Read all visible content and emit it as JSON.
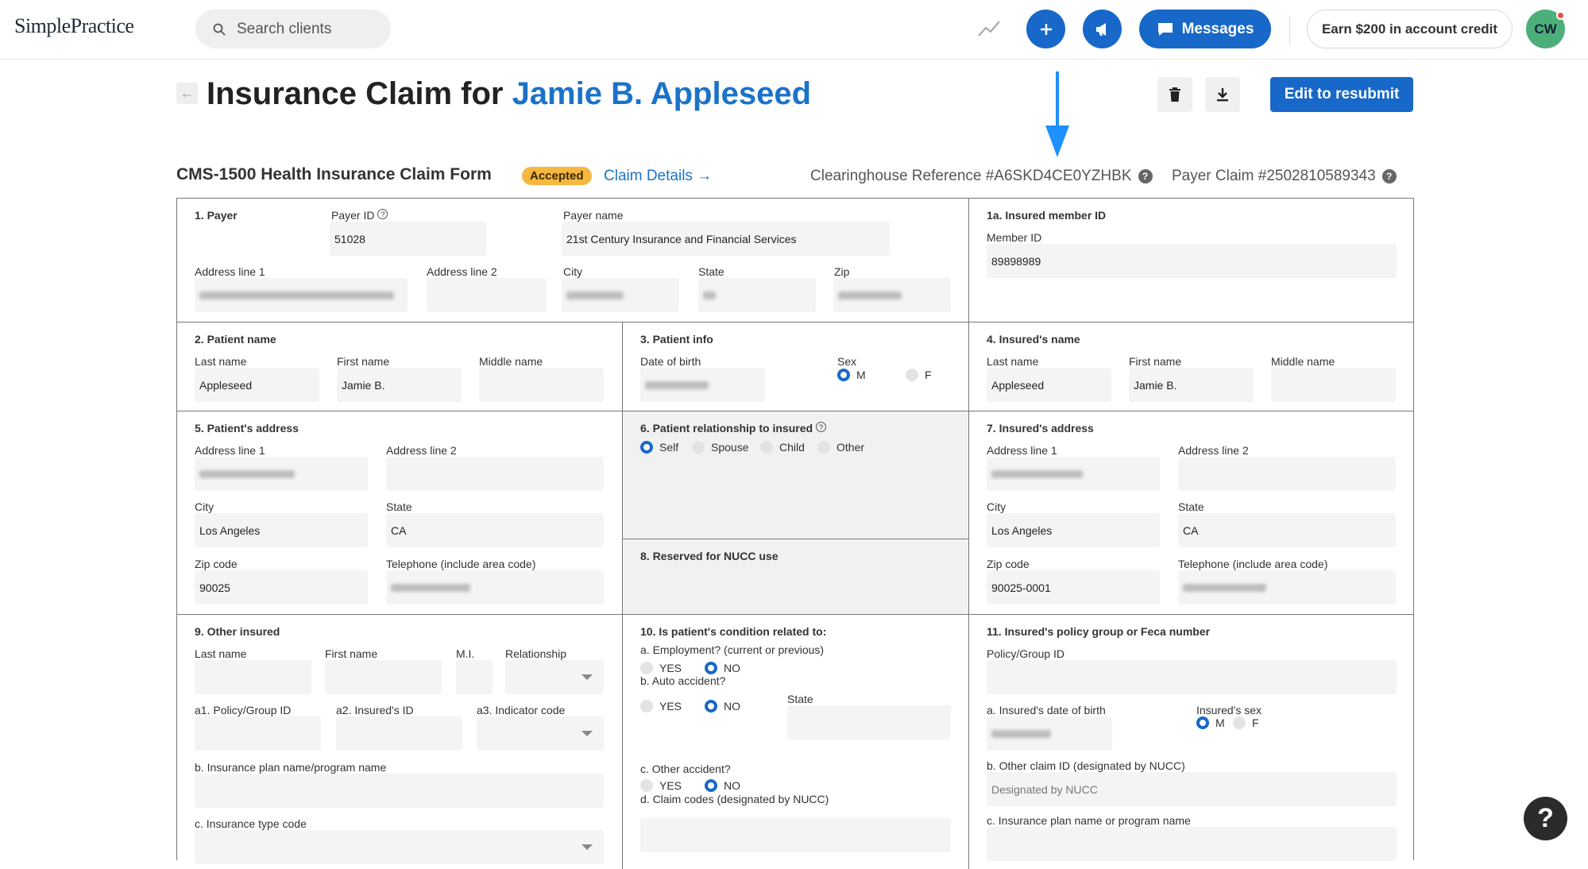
{
  "header": {
    "logo": "SimplePractice",
    "search_placeholder": "Search clients",
    "messages_label": "Messages",
    "earn_label": "Earn $200 in account credit",
    "avatar_initials": "CW"
  },
  "page": {
    "title_prefix": "Insurance Claim for",
    "client_name": "Jamie B. Appleseed",
    "edit_button": "Edit to resubmit"
  },
  "form_header": {
    "title": "CMS-1500 Health Insurance Claim Form",
    "status": "Accepted",
    "claim_details_link": "Claim Details →",
    "clearinghouse_ref": "Clearinghouse Reference #A6SKD4CE0YZHBK",
    "payer_claim": "Payer Claim #2502810589343"
  },
  "s1": {
    "title": "1. Payer",
    "payer_id_label": "Payer ID",
    "payer_id": "51028",
    "payer_name_label": "Payer name",
    "payer_name": "21st Century Insurance and Financial Services",
    "address1_label": "Address line 1",
    "address2_label": "Address line 2",
    "city_label": "City",
    "state_label": "State",
    "zip_label": "Zip"
  },
  "s1a": {
    "title": "1a. Insured member ID",
    "member_id_label": "Member ID",
    "member_id": "89898989"
  },
  "s2": {
    "title": "2. Patient name",
    "last_label": "Last name",
    "last": "Appleseed",
    "first_label": "First name",
    "first": "Jamie B.",
    "middle_label": "Middle name"
  },
  "s3": {
    "title": "3. Patient info",
    "dob_label": "Date of birth",
    "sex_label": "Sex",
    "m": "M",
    "f": "F"
  },
  "s4": {
    "title": "4. Insured's name",
    "last_label": "Last name",
    "last": "Appleseed",
    "first_label": "First name",
    "first": "Jamie B.",
    "middle_label": "Middle name"
  },
  "s5": {
    "title": "5. Patient's address",
    "address1_label": "Address line 1",
    "address2_label": "Address line 2",
    "city_label": "City",
    "city": "Los Angeles",
    "state_label": "State",
    "state": "CA",
    "zip_label": "Zip code",
    "zip": "90025",
    "phone_label": "Telephone (include area code)"
  },
  "s6": {
    "title": "6. Patient relationship to insured",
    "self": "Self",
    "spouse": "Spouse",
    "child": "Child",
    "other": "Other"
  },
  "s7": {
    "title": "7. Insured's address",
    "address1_label": "Address line 1",
    "address2_label": "Address line 2",
    "city_label": "City",
    "city": "Los Angeles",
    "state_label": "State",
    "state": "CA",
    "zip_label": "Zip code",
    "zip": "90025-0001",
    "phone_label": "Telephone (include area code)"
  },
  "s8": {
    "title": "8. Reserved for NUCC use"
  },
  "s9": {
    "title": "9. Other insured",
    "last_label": "Last name",
    "first_label": "First name",
    "mi_label": "M.I.",
    "rel_label": "Relationship",
    "a1_label": "a1. Policy/Group ID",
    "a2_label": "a2. Insured's ID",
    "a3_label": "a3. Indicator code",
    "b_label": "b. Insurance plan name/program name",
    "c_label": "c. Insurance type code"
  },
  "s10": {
    "title": "10. Is patient's condition related to:",
    "a_label": "a. Employment? (current or previous)",
    "b_label": "b. Auto accident?",
    "state_label": "State",
    "c_label": "c. Other accident?",
    "d_label": "d. Claim codes (designated by NUCC)",
    "yes": "YES",
    "no": "NO"
  },
  "s11": {
    "title": "11. Insured's policy group or Feca number",
    "policy_label": "Policy/Group ID",
    "dob_label": "a. Insured's date of birth",
    "sex_label": "Insured's sex",
    "m": "M",
    "f": "F",
    "b_label": "b. Other claim ID (designated by NUCC)",
    "b_placeholder": "Designated by NUCC",
    "c_label": "c. Insurance plan name or program name"
  },
  "colors": {
    "accent": "#1768c9",
    "badge": "#f4b740",
    "link": "#1a73c9"
  },
  "help_label": "?"
}
